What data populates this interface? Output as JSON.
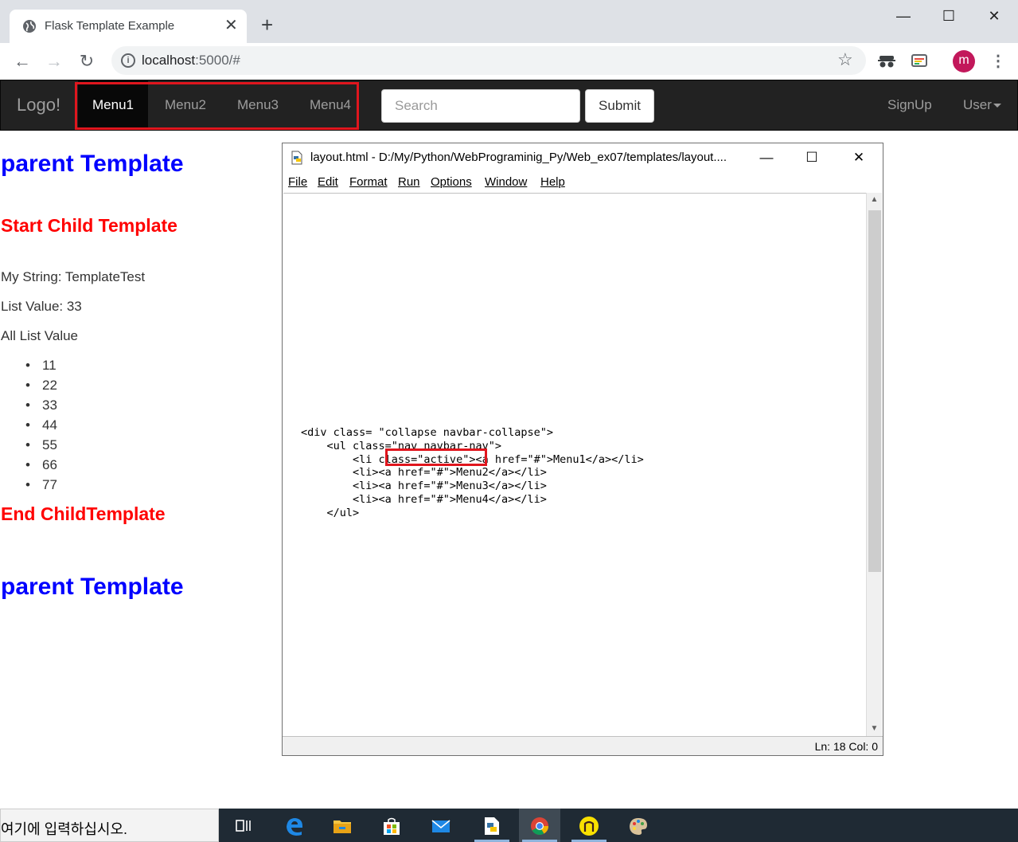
{
  "browser": {
    "tab_title": "Flask Template Example",
    "tab_close": "✕",
    "new_tab": "+",
    "url_host": "localhost",
    "url_rest": ":5000/#",
    "avatar_letter": "m",
    "window_controls": {
      "minimize": "—",
      "maximize": "☐",
      "close": "✕"
    }
  },
  "navbar": {
    "brand": "Logo!",
    "menu": [
      {
        "label": "Menu1",
        "active": true
      },
      {
        "label": "Menu2",
        "active": false
      },
      {
        "label": "Menu3",
        "active": false
      },
      {
        "label": "Menu4",
        "active": false
      }
    ],
    "search_placeholder": "Search",
    "submit_label": "Submit",
    "signup_label": "SignUp",
    "user_label": "User"
  },
  "content": {
    "parent_top": "parent Template",
    "child_start": "Start Child Template",
    "my_string": "My String: TemplateTest",
    "list_value": "List Value: 33",
    "all_list_label": "All List Value",
    "list_items": [
      "11",
      "22",
      "33",
      "44",
      "55",
      "66",
      "77"
    ],
    "child_end": "End ChildTemplate",
    "parent_bottom": "parent Template"
  },
  "editor": {
    "title": "layout.html - D:/My/Python/WebPrograminig_Py/Web_ex07/templates/layout....",
    "menu": [
      "File",
      "Edit",
      "Format",
      "Run",
      "Options",
      "Window",
      "Help"
    ],
    "code": "<div class= \"collapse navbar-collapse\">\n    <ul class=\"nav navbar-nav\">\n        <li class=\"active\"><a href=\"#\">Menu1</a></li>\n        <li><a href=\"#\">Menu2</a></li>\n        <li><a href=\"#\">Menu3</a></li>\n        <li><a href=\"#\">Menu4</a></li>\n    </ul>",
    "status": "Ln: 18   Col: 0"
  },
  "taskbar": {
    "search_text": "여기에 입력하십시오.",
    "apps": [
      "task-view",
      "edge",
      "file-explorer",
      "store",
      "mail",
      "python-idle",
      "chrome",
      "kakao",
      "paint"
    ]
  },
  "colors": {
    "navbar_bg": "#222222",
    "highlight_red": "#e0161e",
    "heading_blue": "#0000ff",
    "heading_red": "#ff0000"
  }
}
